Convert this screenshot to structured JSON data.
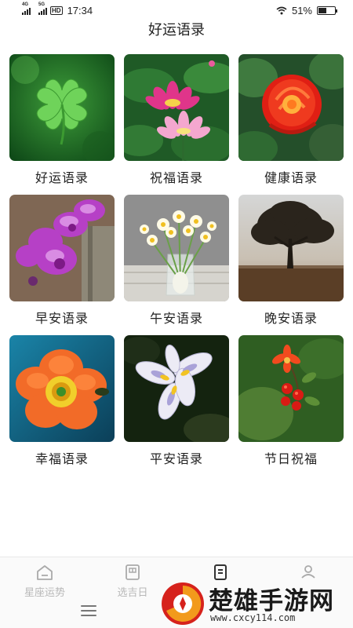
{
  "status_bar": {
    "network1": "4G",
    "network2": "5G",
    "hd": "HD",
    "time": "17:34",
    "battery": "51%",
    "battery_level": 0.51
  },
  "page_title": "好运语录",
  "cards": [
    {
      "label": "好运语录",
      "image": "four-leaf-clover"
    },
    {
      "label": "祝福语录",
      "image": "lotus-flowers"
    },
    {
      "label": "健康语录",
      "image": "red-rose"
    },
    {
      "label": "早安语录",
      "image": "purple-orchid"
    },
    {
      "label": "午安语录",
      "image": "daffodils-in-vase"
    },
    {
      "label": "晚安语录",
      "image": "lone-tree"
    },
    {
      "label": "幸福语录",
      "image": "orange-poppy"
    },
    {
      "label": "平安语录",
      "image": "white-iris"
    },
    {
      "label": "节日祝福",
      "image": "pomegranate-blossom"
    }
  ],
  "tabbar": {
    "tabs": [
      {
        "label": "星座运势",
        "icon": "home-icon"
      },
      {
        "label": "选吉日",
        "icon": "calendar-icon"
      },
      {
        "label": "",
        "icon": "document-icon"
      },
      {
        "label": "",
        "icon": "user-icon"
      }
    ]
  },
  "watermark": {
    "title": "楚雄手游网",
    "url": "www.cxcy114.com"
  },
  "colors": {
    "accent_orange": "#f29a1c",
    "watermark_red": "#d6221c"
  }
}
